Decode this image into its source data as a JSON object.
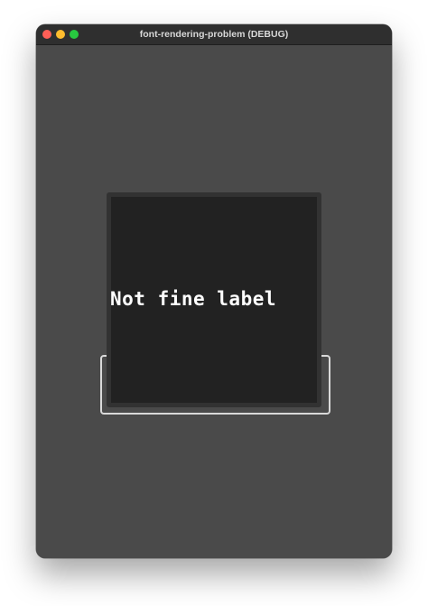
{
  "window": {
    "title": "font-rendering-problem (DEBUG)",
    "controls": {
      "close": "close-button",
      "minimize": "minimize-button",
      "zoom": "zoom-button"
    }
  },
  "content": {
    "label_text": "Not fine label"
  },
  "colors": {
    "window_background": "#4a4a4a",
    "titlebar": "#2f2f2f",
    "panel_outer": "#323232",
    "panel_inner": "#222222",
    "outline": "#d9d9d9",
    "label": "#ffffff"
  }
}
